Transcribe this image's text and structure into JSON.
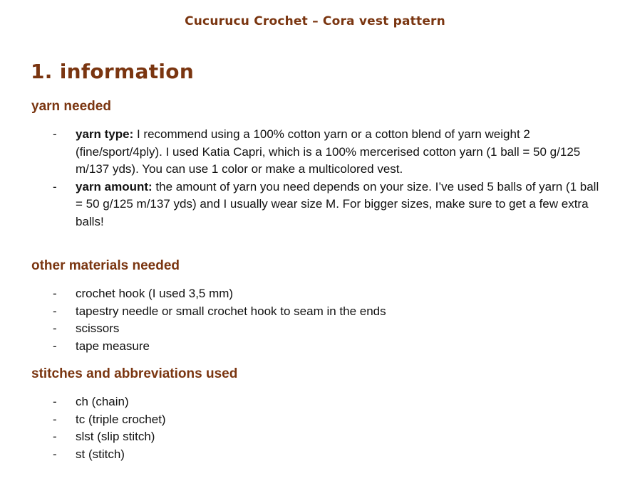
{
  "document": {
    "header": "Cucurucu Crochet – Cora vest pattern",
    "section_title": "1. information",
    "bullet_symbol": "-",
    "yarn": {
      "heading": "yarn needed",
      "items": [
        {
          "term": "yarn type:",
          "text": " I recommend using a 100% cotton yarn or a cotton blend of yarn weight 2 (fine/sport/4ply). I used Katia Capri, which is a 100% mercerised cotton yarn (1 ball = 50 g/125 m/137 yds). You can use 1 color or make a multicolored vest."
        },
        {
          "term": "yarn amount:",
          "text": " the amount of yarn you need depends on your size. I’ve used 5 balls of yarn (1 ball = 50 g/125 m/137 yds) and I usually wear size M. For bigger sizes, make sure to get a few extra balls!"
        }
      ]
    },
    "materials": {
      "heading": "other materials needed",
      "items": [
        "crochet hook (I used 3,5 mm)",
        "tapestry needle or small crochet hook to seam in the ends",
        "scissors",
        "tape measure"
      ]
    },
    "stitches": {
      "heading": "stitches and abbreviations used",
      "items": [
        "ch (chain)",
        "tc (triple crochet)",
        "slst (slip stitch)",
        "st (stitch)"
      ]
    }
  },
  "colors": {
    "heading": "#7a3510",
    "body_text": "#111111",
    "background": "#ffffff"
  }
}
